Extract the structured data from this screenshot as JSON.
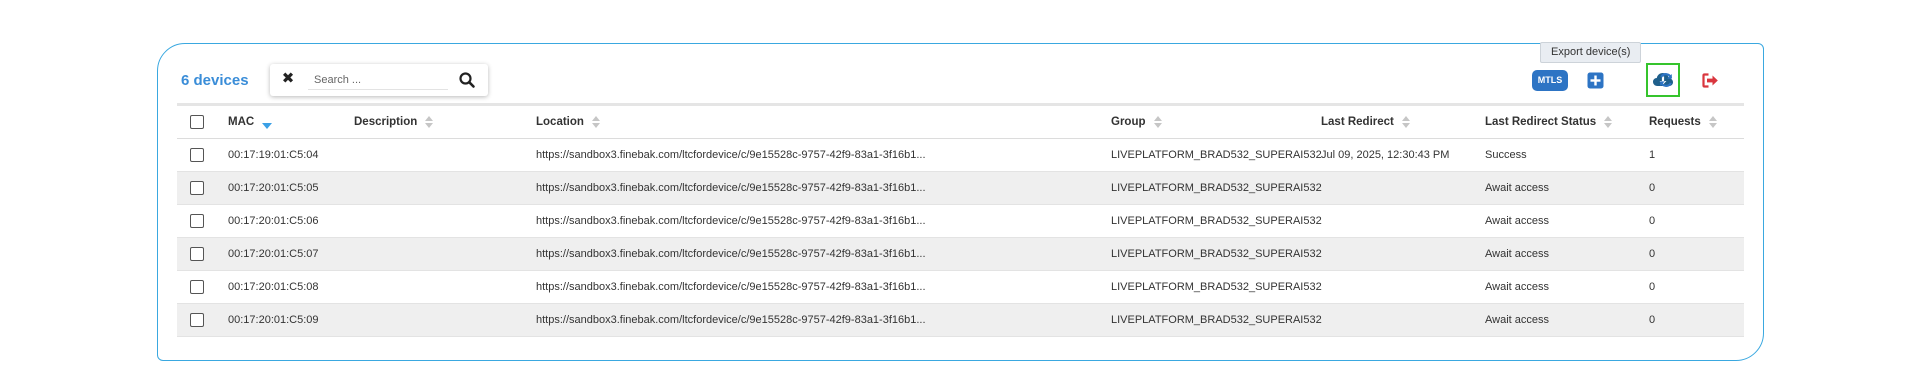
{
  "header": {
    "device_count": "6 devices"
  },
  "search": {
    "placeholder": "Search ..."
  },
  "toolbar": {
    "mtls_label": "MTLS",
    "export_tooltip": "Export device(s)",
    "add_icon": "plus-square-icon",
    "export_icon": "cloud-download-icon",
    "refresh_icon": "refresh-icon",
    "logout_icon": "sign-out-icon"
  },
  "table": {
    "columns": [
      "MAC",
      "Description",
      "Location",
      "Group",
      "Last Redirect",
      "Last Redirect Status",
      "Requests"
    ],
    "sorted_column": "MAC",
    "sort_direction": "descending",
    "rows": [
      {
        "mac": "00:17:19:01:C5:04",
        "description": "",
        "location": "https://sandbox3.finebak.com/ltcfordevice/c/9e15528c-9757-42f9-83a1-3f16b1...",
        "group": "LIVEPLATFORM_BRAD532_SUPERAI532",
        "last_redirect": "Jul 09, 2025, 12:30:43 PM",
        "status": "Success",
        "requests": "1"
      },
      {
        "mac": "00:17:20:01:C5:05",
        "description": "",
        "location": "https://sandbox3.finebak.com/ltcfordevice/c/9e15528c-9757-42f9-83a1-3f16b1...",
        "group": "LIVEPLATFORM_BRAD532_SUPERAI532",
        "last_redirect": "",
        "status": "Await access",
        "requests": "0"
      },
      {
        "mac": "00:17:20:01:C5:06",
        "description": "",
        "location": "https://sandbox3.finebak.com/ltcfordevice/c/9e15528c-9757-42f9-83a1-3f16b1...",
        "group": "LIVEPLATFORM_BRAD532_SUPERAI532",
        "last_redirect": "",
        "status": "Await access",
        "requests": "0"
      },
      {
        "mac": "00:17:20:01:C5:07",
        "description": "",
        "location": "https://sandbox3.finebak.com/ltcfordevice/c/9e15528c-9757-42f9-83a1-3f16b1...",
        "group": "LIVEPLATFORM_BRAD532_SUPERAI532",
        "last_redirect": "",
        "status": "Await access",
        "requests": "0"
      },
      {
        "mac": "00:17:20:01:C5:08",
        "description": "",
        "location": "https://sandbox3.finebak.com/ltcfordevice/c/9e15528c-9757-42f9-83a1-3f16b1...",
        "group": "LIVEPLATFORM_BRAD532_SUPERAI532",
        "last_redirect": "",
        "status": "Await access",
        "requests": "0"
      },
      {
        "mac": "00:17:20:01:C5:09",
        "description": "",
        "location": "https://sandbox3.finebak.com/ltcfordevice/c/9e15528c-9757-42f9-83a1-3f16b1...",
        "group": "LIVEPLATFORM_BRAD532_SUPERAI532",
        "last_redirect": "",
        "status": "Await access",
        "requests": "0"
      }
    ]
  },
  "colors": {
    "accent": "#3a8dd8",
    "panel_border": "#3aa8e0",
    "mtls_bg": "#2d74c4",
    "export_highlight": "#35c42c",
    "logout": "#d9363e",
    "row_alt": "#efefef"
  }
}
